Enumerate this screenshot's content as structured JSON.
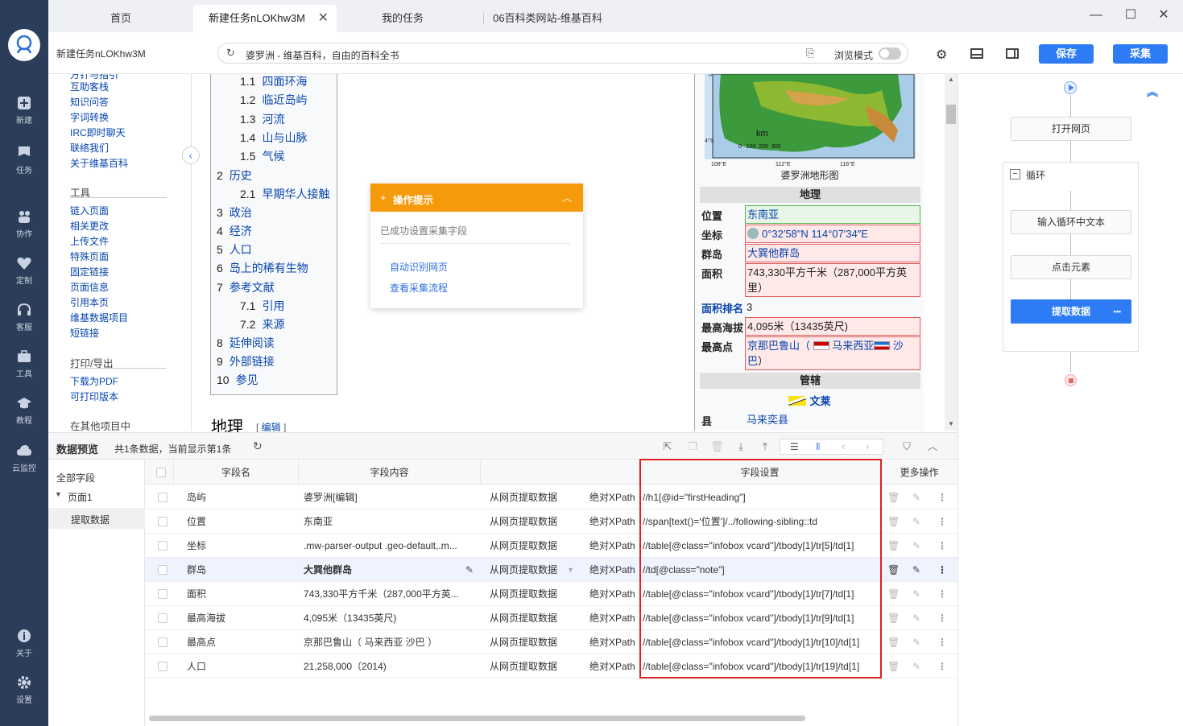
{
  "tabs": [
    {
      "label": "首页"
    },
    {
      "label": "新建任务nLOKhw3M"
    },
    {
      "label": "我的任务"
    },
    {
      "label": "06百科类网站-维基百科"
    }
  ],
  "sidebar": {
    "items": [
      {
        "label": "新建"
      },
      {
        "label": "任务"
      },
      {
        "label": "协作"
      },
      {
        "label": "定制"
      },
      {
        "label": "客服"
      },
      {
        "label": "工具"
      },
      {
        "label": "教程"
      },
      {
        "label": "云监控"
      },
      {
        "label": "关于"
      },
      {
        "label": "设置"
      }
    ]
  },
  "toolbar": {
    "task_name": "新建任务nLOKhw3M",
    "address": "婆罗洲 - 维基百科，自由的百科全书",
    "browse_mode": "浏览模式",
    "save": "保存",
    "collect": "采集"
  },
  "wiki_sidebar": {
    "links_top": [
      "互助客栈",
      "知识问答",
      "字词转换",
      "IRC即时聊天",
      "联络我们",
      "关于维基百科"
    ],
    "tools_head": "工具",
    "tools": [
      "链入页面",
      "相关更改",
      "上传文件",
      "特殊页面",
      "固定链接",
      "页面信息",
      "引用本页",
      "维基数据项目",
      "短链接"
    ],
    "print_head": "打印/导出",
    "print": [
      "下载为PDF",
      "可打印版本"
    ],
    "other_head": "在其他项目中"
  },
  "toc": [
    {
      "num": "1.1",
      "text": "四面环海",
      "sub": true
    },
    {
      "num": "1.2",
      "text": "临近岛屿",
      "sub": true
    },
    {
      "num": "1.3",
      "text": "河流",
      "sub": true
    },
    {
      "num": "1.4",
      "text": "山与山脉",
      "sub": true
    },
    {
      "num": "1.5",
      "text": "气候",
      "sub": true
    },
    {
      "num": "2",
      "text": "历史",
      "sub": false
    },
    {
      "num": "2.1",
      "text": "早期华人接触",
      "sub": true
    },
    {
      "num": "3",
      "text": "政治",
      "sub": false
    },
    {
      "num": "4",
      "text": "经济",
      "sub": false
    },
    {
      "num": "5",
      "text": "人口",
      "sub": false
    },
    {
      "num": "6",
      "text": "岛上的稀有生物",
      "sub": false
    },
    {
      "num": "7",
      "text": "参考文献",
      "sub": false
    },
    {
      "num": "7.1",
      "text": "引用",
      "sub": true
    },
    {
      "num": "7.2",
      "text": "来源",
      "sub": true
    },
    {
      "num": "8",
      "text": "延伸阅读",
      "sub": false
    },
    {
      "num": "9",
      "text": "外部链接",
      "sub": false
    },
    {
      "num": "10",
      "text": "参见",
      "sub": false
    }
  ],
  "article": {
    "heading": "地理",
    "edit": "编辑"
  },
  "tip": {
    "title": "操作提示",
    "message": "已成功设置采集字段",
    "links": [
      "自动识别网页",
      "查看采集流程"
    ]
  },
  "infobox": {
    "map_caption": "婆罗洲地形图",
    "map_labels": {
      "lat0": "0°",
      "lat4": "4°S",
      "km": "km",
      "scale": "0   100  200  300",
      "lon1": "108°E",
      "lon2": "112°E",
      "lon3": "116°E"
    },
    "section_geo": "地理",
    "rows": [
      {
        "label": "位置",
        "value": "东南亚"
      },
      {
        "label": "坐标",
        "value": "0°32′58″N 114°07′34″E"
      },
      {
        "label": "群岛",
        "value": "大巽他群岛"
      },
      {
        "label": "面积",
        "value": "743,330平方千米（287,000平方英里）"
      },
      {
        "label": "面积排名",
        "value": "3"
      },
      {
        "label": "最高海拔",
        "value": "4,095米（13435英尺)"
      },
      {
        "label": "最高点",
        "value": "京那巴鲁山（",
        "value2": "马来西亚",
        "value3": "沙巴",
        "value4": "）"
      }
    ],
    "section_admin": "管辖",
    "country": "文莱",
    "county_label": "县",
    "county_value": "马来奕县"
  },
  "flow": {
    "nodes": [
      "打开网页",
      "循环",
      "输入循环中文本",
      "点击元素",
      "提取数据"
    ],
    "more": "•••"
  },
  "data_preview": {
    "title": "数据预览",
    "summary": "共1条数据，当前显示第1条",
    "tree": {
      "all": "全部字段",
      "page": "页面1",
      "extract": "提取数据"
    },
    "columns": [
      "字段名",
      "字段内容",
      "字段设置",
      "更多操作"
    ],
    "rows": [
      {
        "name": "岛屿",
        "content": "婆罗洲[编辑]",
        "source": "从网页提取数据",
        "xpath_type": "绝对XPath",
        "xpath": "//h1[@id=\"firstHeading\"]"
      },
      {
        "name": "位置",
        "content": "东南亚",
        "source": "从网页提取数据",
        "xpath_type": "绝对XPath",
        "xpath": "//span[text()='位置']/../following-sibling::td"
      },
      {
        "name": "坐标",
        "content": ".mw-parser-output .geo-default,.m...",
        "source": "从网页提取数据",
        "xpath_type": "绝对XPath",
        "xpath": "//table[@class=\"infobox vcard\"]/tbody[1]/tr[5]/td[1]"
      },
      {
        "name": "群岛",
        "content": "大巽他群岛",
        "source": "从网页提取数据",
        "xpath_type": "绝对XPath",
        "xpath": "//td[@class=\"note\"]"
      },
      {
        "name": "面积",
        "content": "743,330平方千米（287,000平方英...",
        "source": "从网页提取数据",
        "xpath_type": "绝对XPath",
        "xpath": "//table[@class=\"infobox vcard\"]/tbody[1]/tr[7]/td[1]"
      },
      {
        "name": "最高海拔",
        "content": "4,095米（13435英尺)",
        "source": "从网页提取数据",
        "xpath_type": "绝对XPath",
        "xpath": "//table[@class=\"infobox vcard\"]/tbody[1]/tr[9]/td[1]"
      },
      {
        "name": "最高点",
        "content": "京那巴鲁山（ 马来西亚 沙巴 ）",
        "source": "从网页提取数据",
        "xpath_type": "绝对XPath",
        "xpath": "//table[@class=\"infobox vcard\"]/tbody[1]/tr[10]/td[1]"
      },
      {
        "name": "人口",
        "content": "21,258,000（2014)",
        "source": "从网页提取数据",
        "xpath_type": "绝对XPath",
        "xpath": "//table[@class=\"infobox vcard\"]/tbody[1]/tr[19]/td[1]"
      }
    ]
  },
  "colors": {
    "accent": "#2d7bf5",
    "sidebar": "#2c3d59",
    "tip": "#f59a0a",
    "highlight": "#e02020"
  }
}
